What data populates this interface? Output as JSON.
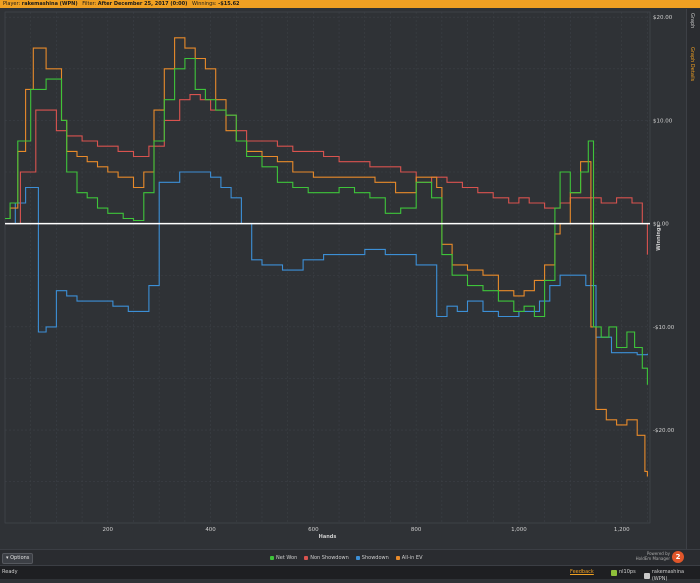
{
  "header": {
    "player_label": "Player:",
    "player_name": "rakemashina (WPN)",
    "filter_label": "Filter:",
    "filter_value": "After December 25, 2017 (0:00)",
    "winnings_label": "Winnings:",
    "winnings_value": "-$15.62"
  },
  "side_tabs": {
    "graph": "Graph",
    "details": "Graph Details"
  },
  "bottom": {
    "options": "Options",
    "powered_by": "Powered by",
    "brand": "HoldEm Manager",
    "brand_badge": "2"
  },
  "status": {
    "ready": "Ready",
    "feedback": "Feedback",
    "site": "nl10ps",
    "player": "rakemashina (WPN)"
  },
  "colors": {
    "net_won": "#3ec43a",
    "non_showdown": "#d9534f",
    "showdown": "#3c8fd6",
    "all_in_ev": "#e88a2a",
    "accent": "#f0a022"
  },
  "chart_data": {
    "type": "line",
    "xlabel": "Hands",
    "ylabel": "Winnings",
    "x_ticks": [
      200,
      400,
      600,
      800,
      1000,
      1200
    ],
    "x_tick_labels": [
      "200",
      "400",
      "600",
      "800",
      "1,000",
      "1,200"
    ],
    "y_ticks": [
      20,
      10,
      0,
      -10,
      -20
    ],
    "y_tick_labels": [
      "$20.00",
      "$10.00",
      "$0.00",
      "-$10.00",
      "-$20.00"
    ],
    "xlim": [
      0,
      1255
    ],
    "ylim": [
      -29,
      20.5
    ],
    "grid": true,
    "legend_position": "bottom-center",
    "series": [
      {
        "name": "Net Won",
        "x": [
          0,
          10,
          25,
          50,
          80,
          110,
          120,
          140,
          160,
          180,
          200,
          230,
          250,
          270,
          290,
          310,
          330,
          350,
          370,
          390,
          410,
          430,
          450,
          470,
          500,
          530,
          560,
          590,
          620,
          650,
          680,
          710,
          740,
          770,
          800,
          830,
          850,
          870,
          900,
          930,
          960,
          990,
          1010,
          1030,
          1050,
          1070,
          1080,
          1100,
          1120,
          1135,
          1145,
          1160,
          1175,
          1190,
          1210,
          1225,
          1240,
          1250
        ],
        "y": [
          0.5,
          2,
          8,
          13,
          14,
          10,
          5,
          3,
          2.5,
          1.5,
          1,
          0.5,
          0.3,
          3,
          8,
          12,
          15,
          16,
          13,
          12,
          11,
          10.5,
          8,
          6.5,
          5.5,
          4,
          3.5,
          3,
          3,
          3.5,
          3,
          2.5,
          1,
          1.5,
          4,
          2.5,
          -3,
          -5,
          -6,
          -6.5,
          -7.5,
          -8.5,
          -8,
          -9,
          -5.5,
          1.5,
          5,
          3,
          5,
          8,
          -10,
          -11,
          -10,
          -12,
          -10.5,
          -12,
          -14,
          -15.6
        ]
      },
      {
        "name": "Non Showdown",
        "x": [
          0,
          30,
          60,
          100,
          120,
          150,
          180,
          220,
          250,
          280,
          310,
          340,
          360,
          380,
          400,
          430,
          450,
          470,
          500,
          530,
          560,
          590,
          620,
          650,
          680,
          710,
          740,
          770,
          800,
          830,
          860,
          890,
          920,
          950,
          980,
          1000,
          1020,
          1050,
          1080,
          1100,
          1130,
          1160,
          1190,
          1220,
          1240,
          1250
        ],
        "y": [
          0,
          5,
          11,
          9,
          8.5,
          8,
          7.5,
          7,
          6.5,
          7.5,
          10,
          12,
          12.5,
          12,
          11,
          10.5,
          9,
          8,
          8,
          7.5,
          7,
          7,
          6.5,
          6,
          6,
          5.5,
          5.5,
          5,
          4,
          4.5,
          4,
          3.5,
          3,
          2.5,
          2,
          2.5,
          2,
          1.5,
          2,
          2.5,
          2.5,
          2,
          2.5,
          2,
          0,
          -3
        ]
      },
      {
        "name": "Showdown",
        "x": [
          0,
          20,
          40,
          60,
          65,
          80,
          100,
          120,
          140,
          170,
          210,
          240,
          270,
          280,
          300,
          340,
          380,
          400,
          420,
          440,
          460,
          480,
          500,
          505,
          540,
          580,
          620,
          660,
          700,
          740,
          780,
          800,
          830,
          840,
          860,
          880,
          900,
          930,
          960,
          1000,
          1040,
          1060,
          1080,
          1100,
          1130,
          1150,
          1180,
          1200,
          1230,
          1250
        ],
        "y": [
          0,
          2,
          3.5,
          3.5,
          -10.5,
          -10,
          -6.5,
          -7,
          -7.5,
          -7.5,
          -8,
          -8.5,
          -8.5,
          -6,
          4,
          5,
          5,
          4.5,
          3.5,
          2.5,
          0,
          -3.5,
          -4,
          -4,
          -4.5,
          -3.5,
          -3,
          -3,
          -2.5,
          -3,
          -3,
          -4,
          -4,
          -9,
          -8,
          -8.5,
          -7.5,
          -8.5,
          -9,
          -8.5,
          -7.5,
          -6,
          -5,
          -5,
          -6,
          -11,
          -12.5,
          -12.5,
          -12.7,
          -12.6
        ]
      },
      {
        "name": "All-in EV",
        "x": [
          0,
          10,
          25,
          40,
          55,
          80,
          110,
          120,
          140,
          160,
          180,
          200,
          220,
          250,
          270,
          290,
          310,
          330,
          340,
          350,
          370,
          390,
          410,
          430,
          450,
          470,
          500,
          530,
          560,
          600,
          640,
          680,
          720,
          760,
          800,
          840,
          850,
          870,
          900,
          930,
          960,
          990,
          1010,
          1030,
          1050,
          1070,
          1080,
          1100,
          1120,
          1140,
          1150,
          1170,
          1190,
          1210,
          1230,
          1245,
          1250
        ],
        "y": [
          0.5,
          1.5,
          7,
          13,
          17,
          15,
          10,
          7,
          6.5,
          6,
          5.5,
          5,
          4.5,
          3.5,
          5,
          11,
          15,
          18,
          18,
          17,
          16,
          15,
          12,
          9,
          8,
          7,
          6.5,
          6,
          5,
          4.5,
          4.5,
          4.5,
          4,
          3,
          4.5,
          3.5,
          -2,
          -4,
          -4.5,
          -5,
          -6.5,
          -7,
          -6.5,
          -5.5,
          -4,
          -1,
          0,
          3,
          6,
          -10,
          -18,
          -19,
          -19.5,
          -19,
          -20.5,
          -24,
          -24.5
        ]
      }
    ]
  }
}
